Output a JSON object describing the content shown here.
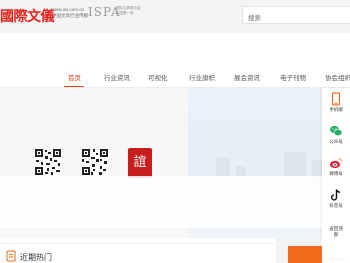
{
  "header": {
    "logo_text": "國際文儀",
    "logo_sub_line1": "www.iss.com.cn",
    "logo_sub_line2": "中国文具行业传媒",
    "logo_isp": "ISPA",
    "logo_right_line1": "国际文具联合会",
    "logo_right_line2": "中国第一家",
    "search_placeholder": "搜索"
  },
  "nav": {
    "items": [
      {
        "label": "首页",
        "active": true
      },
      {
        "label": "行业资讯",
        "active": false
      },
      {
        "label": "可视化",
        "active": false
      },
      {
        "label": "行业旗帜",
        "active": false
      },
      {
        "label": "展会资讯",
        "active": false
      },
      {
        "label": "电子刊物",
        "active": false
      },
      {
        "label": "协会组织",
        "active": false
      }
    ]
  },
  "banner": {
    "seal_text": "誼"
  },
  "sidebar": {
    "items": [
      {
        "label": "手机端",
        "icon": "phone-icon"
      },
      {
        "label": "公众号",
        "icon": "wechat-icon"
      },
      {
        "label": "微博号",
        "icon": "weibo-icon"
      },
      {
        "label": "抖音号",
        "icon": "douyin-icon"
      },
      {
        "label": "返回顶部",
        "icon": "back-to-top-icon"
      }
    ]
  },
  "hot": {
    "title": "近期热门"
  },
  "colors": {
    "brand_red": "#e8231a",
    "accent_orange": "#f26a1b",
    "nav_active": "#e8401a"
  }
}
